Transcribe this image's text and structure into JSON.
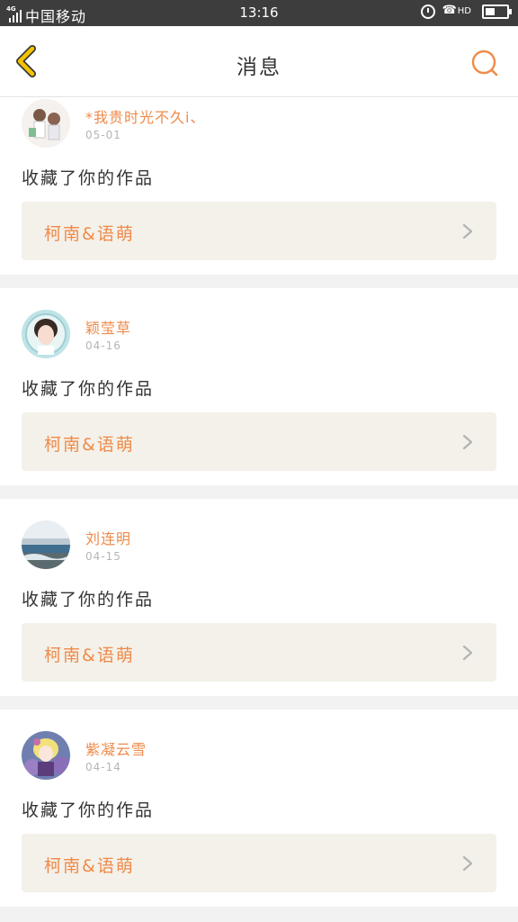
{
  "status_bar": {
    "network": "4G",
    "carrier": "中国移动",
    "time": "13:16",
    "hd_label": "HD",
    "battery_level": 0.45,
    "icons": [
      "signal-icon",
      "alarm-icon",
      "hd-call-icon",
      "battery-icon"
    ]
  },
  "header": {
    "title": "消息",
    "back_icon": "chevron-left-icon",
    "search_icon": "search-icon"
  },
  "colors": {
    "accent": "#f08a4a",
    "back_icon": "#f5c400",
    "card_link_bg": "#f3f1e9",
    "page_bg": "#f2f2f2",
    "status_bar_bg": "#3d3d3d"
  },
  "messages": [
    {
      "user_name": "*我贵时光不久i、",
      "date": "05-01",
      "action": "收藏了你的作品",
      "work_title": "柯南&语萌"
    },
    {
      "user_name": "颖莹草",
      "date": "04-16",
      "action": "收藏了你的作品",
      "work_title": "柯南&语萌"
    },
    {
      "user_name": "刘连明",
      "date": "04-15",
      "action": "收藏了你的作品",
      "work_title": "柯南&语萌"
    },
    {
      "user_name": "紫凝云雪",
      "date": "04-14",
      "action": "收藏了你的作品",
      "work_title": "柯南&语萌"
    }
  ]
}
